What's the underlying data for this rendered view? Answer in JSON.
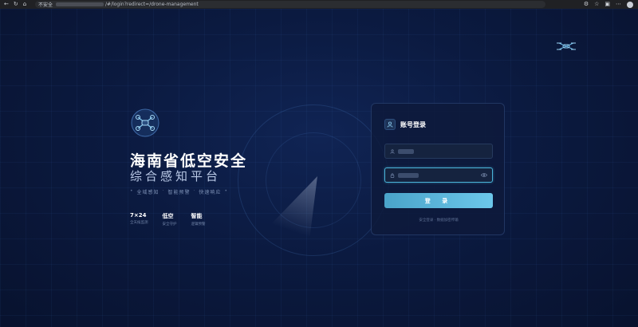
{
  "browser": {
    "security_label": "不安全",
    "url_path": "/#/login?redirect=/drone-management"
  },
  "brand": {
    "title": "海南省低空安全",
    "subtitle": "综合感知平台",
    "tagline": [
      "全域感知",
      "智能预警",
      "快速响应"
    ]
  },
  "stats": [
    {
      "value": "7×24",
      "caption": "全天候监测"
    },
    {
      "value": "低空",
      "caption": "安全守护"
    },
    {
      "value": "智能",
      "caption": "逻辑预警"
    }
  ],
  "login": {
    "title": "账号登录",
    "button_label": "登 录",
    "footer": "安全登录 · 数据加密传输"
  },
  "colors": {
    "accent": "#4ab3d8",
    "button_start": "#4aa3c9",
    "button_end": "#6cc7ea",
    "background": "#0a1330"
  }
}
